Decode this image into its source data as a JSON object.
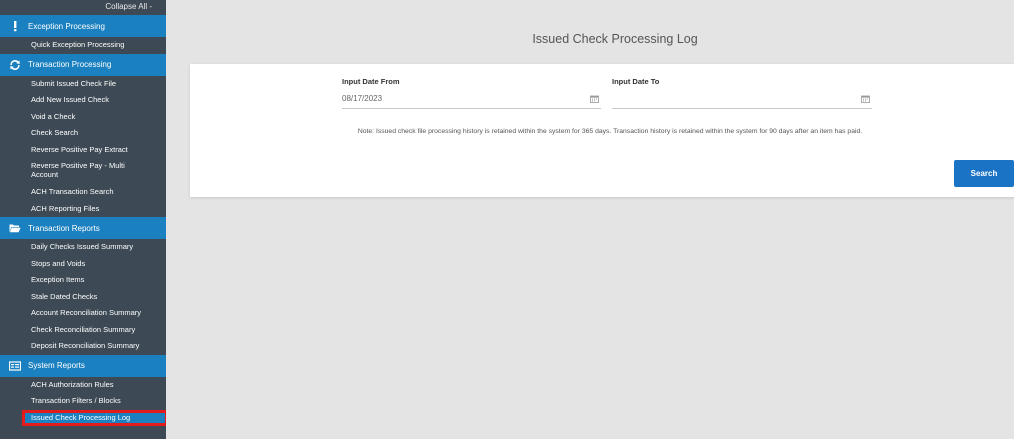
{
  "sidebar": {
    "collapse_label": "Collapse All -",
    "sections": [
      {
        "header": "Exception Processing",
        "icon": "exclamation-icon",
        "items": [
          "Quick Exception Processing"
        ]
      },
      {
        "header": "Transaction Processing",
        "icon": "refresh-icon",
        "items": [
          "Submit Issued Check File",
          "Add New Issued Check",
          "Void a Check",
          "Check Search",
          "Reverse Positive Pay Extract",
          "Reverse Positive Pay - Multi Account",
          "ACH Transaction Search",
          "ACH Reporting Files"
        ]
      },
      {
        "header": "Transaction Reports",
        "icon": "folder-open-icon",
        "items": [
          "Daily Checks Issued Summary",
          "Stops and Voids",
          "Exception Items",
          "Stale Dated Checks",
          "Account Reconciliation Summary",
          "Check Reconciliation Summary",
          "Deposit Reconciliation Summary"
        ]
      },
      {
        "header": "System Reports",
        "icon": "report-icon",
        "items": [
          "ACH Authorization Rules",
          "Transaction Filters / Blocks",
          "Issued Check Processing Log"
        ]
      }
    ]
  },
  "main": {
    "title": "Issued Check Processing Log",
    "from_label": "Input Date From",
    "from_value": "08/17/2023",
    "to_label": "Input Date To",
    "to_value": "",
    "note": "Note: Issued check file processing history is retained within the system for 365 days. Transaction history is retained within the system for 90 days after an item has paid.",
    "search_label": "Search"
  },
  "colors": {
    "sidebar_bg": "#3d4a55",
    "section_header": "#1b80bf",
    "highlight": "#e31b1b",
    "button": "#1b73c6"
  }
}
